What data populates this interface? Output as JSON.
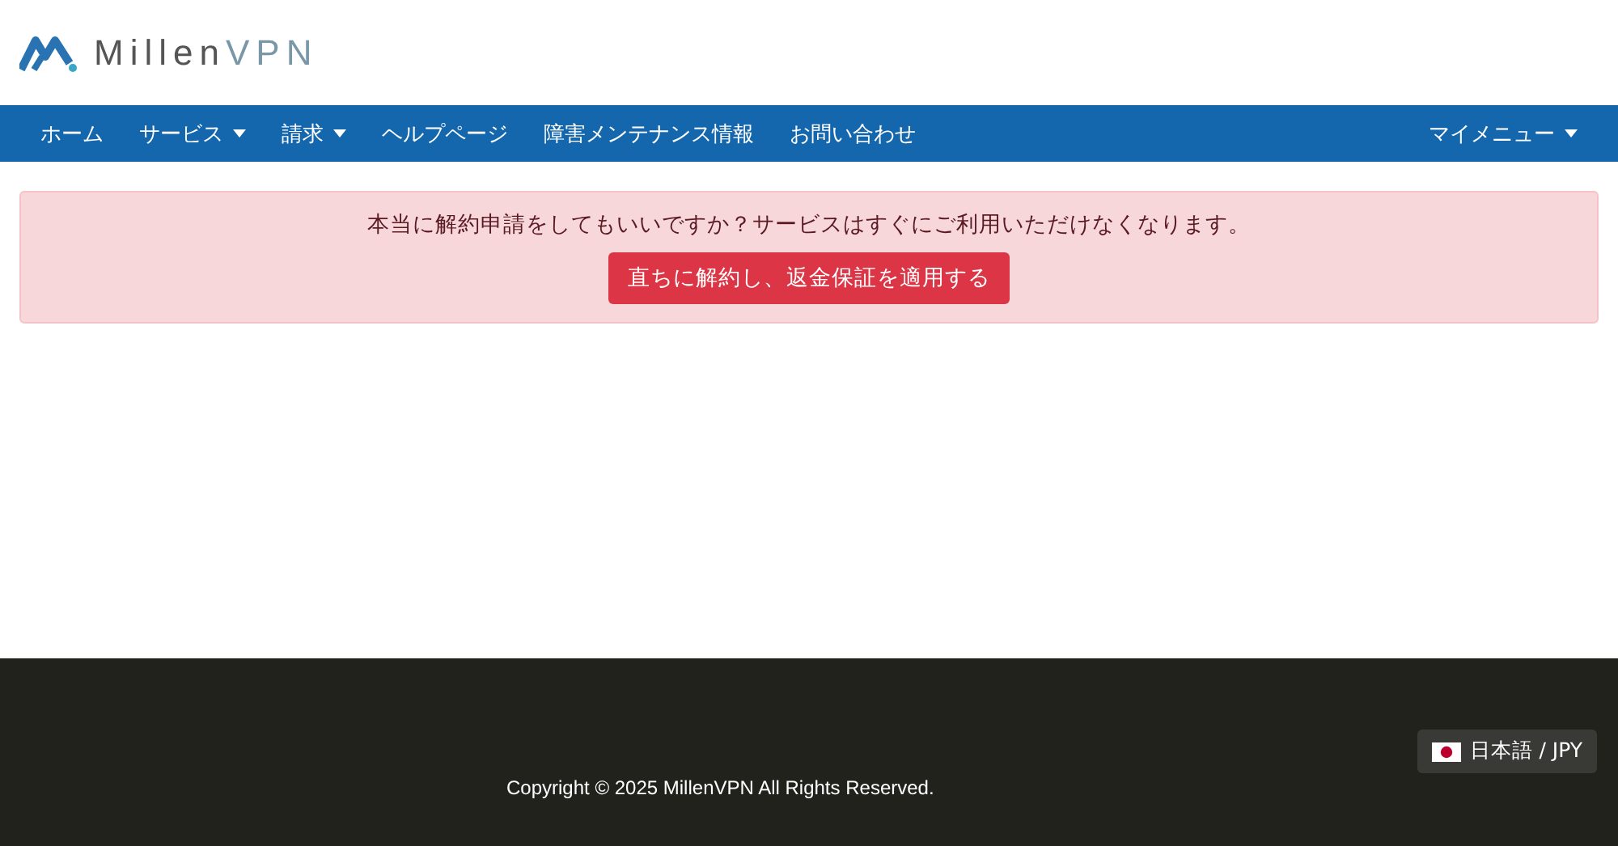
{
  "logo": {
    "primary": "Millen",
    "secondary": "VPN"
  },
  "nav": {
    "items": [
      {
        "label": "ホーム",
        "dropdown": false
      },
      {
        "label": "サービス",
        "dropdown": true
      },
      {
        "label": "請求",
        "dropdown": true
      },
      {
        "label": "ヘルプページ",
        "dropdown": false
      },
      {
        "label": "障害メンテナンス情報",
        "dropdown": false
      },
      {
        "label": "お問い合わせ",
        "dropdown": false
      }
    ],
    "right": {
      "label": "マイメニュー",
      "dropdown": true
    }
  },
  "alert": {
    "message": "本当に解約申請をしてもいいですか？サービスはすぐにご利用いただけなくなります。",
    "button": "直ちに解約し、返金保証を適用する"
  },
  "footer": {
    "copyright": "Copyright © 2025 MillenVPN All Rights Reserved.",
    "language": "日本語 / JPY"
  }
}
